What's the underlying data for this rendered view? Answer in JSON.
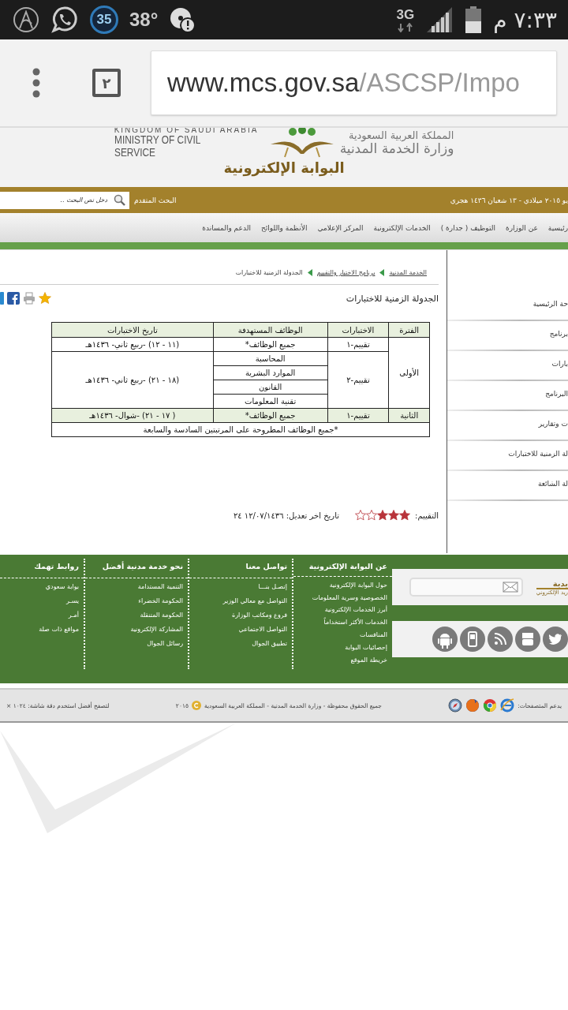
{
  "status_bar": {
    "notification_badge": "35",
    "temperature": "38°",
    "network": "3G",
    "time": "٧:٣٣ م"
  },
  "browser": {
    "tab_count": "٢",
    "url_host": "www.mcs.gov.sa",
    "url_path": "/ASCSP/Impo"
  },
  "header": {
    "english_top": "KINGDOM OF SAUDI ARABIA",
    "english_name": "MINISTRY OF CIVIL SERVICE",
    "arabic_top": "المملكة العربية السعودية",
    "arabic_name": "وزارة الخدمة المدنية",
    "portal_title": "البوابة الإلكترونية"
  },
  "top_bar": {
    "date": "يو ٢٠١٥ ميلادي - ١٣ شعبان ١٤٣٦ هجري",
    "advanced_search": "البحث المتقدم",
    "search_placeholder": "دخل نص البحث .."
  },
  "nav": [
    "رئيسية",
    "عن الوزارة",
    "التوظيف ( جدارة )",
    "الخدمات الإلكترونية",
    "المركز الإعلامي",
    "الأنظمة واللوائح",
    "الدعم والمساندة"
  ],
  "breadcrumb": [
    {
      "label": "الخدمة المدنية",
      "link": true
    },
    {
      "label": "برنامج الاختبار والتقييم",
      "link": true
    },
    {
      "label": "الجدولة الزمنية للاختبارات",
      "link": false
    }
  ],
  "sidebar": {
    "items": [
      "حة الرئيسية",
      "برنامج",
      "بارات",
      "البرنامج",
      "ت وتقارير",
      "لة الزمنية للاختبارات",
      "لة الشائعة"
    ]
  },
  "page_title": "الجدولة الزمنية للاختبارات",
  "table": {
    "columns": [
      "الفترة",
      "الاختبارات",
      "الوظائف المستهدفة",
      "تاريخ الاختبارات"
    ],
    "periods": [
      {
        "period": "الأولى",
        "highlighted": false,
        "tests": [
          {
            "name": "تقييم-١",
            "date": "(١١ - ١٢) -ربيع ثاني- ١٤٣٦هـ",
            "jobs": [
              "جميع الوظائف*"
            ]
          },
          {
            "name": "تقييم-٢",
            "date": "(١٨ - ٢١) -ربيع ثاني- ١٤٣٦هـ",
            "jobs": [
              "المحاسبة",
              "الموارد البشرية",
              "القانون",
              "تقنية المعلومات"
            ]
          }
        ]
      },
      {
        "period": "الثانية",
        "highlighted": true,
        "tests": [
          {
            "name": "تقييم-١",
            "date": "( ١٧ - ٢١) -شوال- ١٤٣٦هـ",
            "jobs": [
              "جميع الوظائف*"
            ]
          }
        ]
      }
    ],
    "note": "*جميع الوظائف المطروحة على المرتبتين السادسة والسابعة"
  },
  "rating": {
    "label": "التقييم:",
    "stars": 3,
    "modified": "تاريخ اخر تعديل: ١٢/٠٧/١٤٣٦ ٢٤"
  },
  "footer": {
    "newsletter_title": "يدية",
    "newsletter_subtitle": "ريد الإلكتروني",
    "columns": [
      {
        "title": "عن البوابة الإلكترونية",
        "links": [
          "حول البوابة الإلكترونية",
          "الخصوصية وسرية المعلومات",
          "أبرز الخدمات الإلكترونية",
          "الخدمات الأكثر استخداماً",
          "المنافسات",
          "إحصائيات البوابة",
          "خريطة الموقع"
        ]
      },
      {
        "title": "تواصل معنا",
        "links": [
          "إتصـل بنـــا",
          "التواصل مع معالي الوزير",
          "فروع ومكاتب الوزارة",
          "التواصل الاجتماعي",
          "تطبيق الجوال"
        ]
      },
      {
        "title": "نحو خدمة مدنية أفضل",
        "links": [
          "التنمية المستدامة",
          "الحكومة الخضراء",
          "الحكومة المتنقلة",
          "المشاركة الإلكترونية",
          "رسائل الجوال"
        ]
      },
      {
        "title": "روابط تهمك",
        "links": [
          "بوابة سعودي",
          "يسـر",
          "أمـر",
          "مواقع ذات صلة"
        ]
      }
    ]
  },
  "bottom_bar": {
    "browsers_label": "يدعم المتصفحات:",
    "copyright": "جميع الحقوق محفوظة - وزارة الخدمة المدنية - المملكة العربية السعودية",
    "year": "٢٠١٥",
    "resolution": "لتصفح أفضل استخدم دقة شاشة: ١٠٢٤ ×"
  }
}
